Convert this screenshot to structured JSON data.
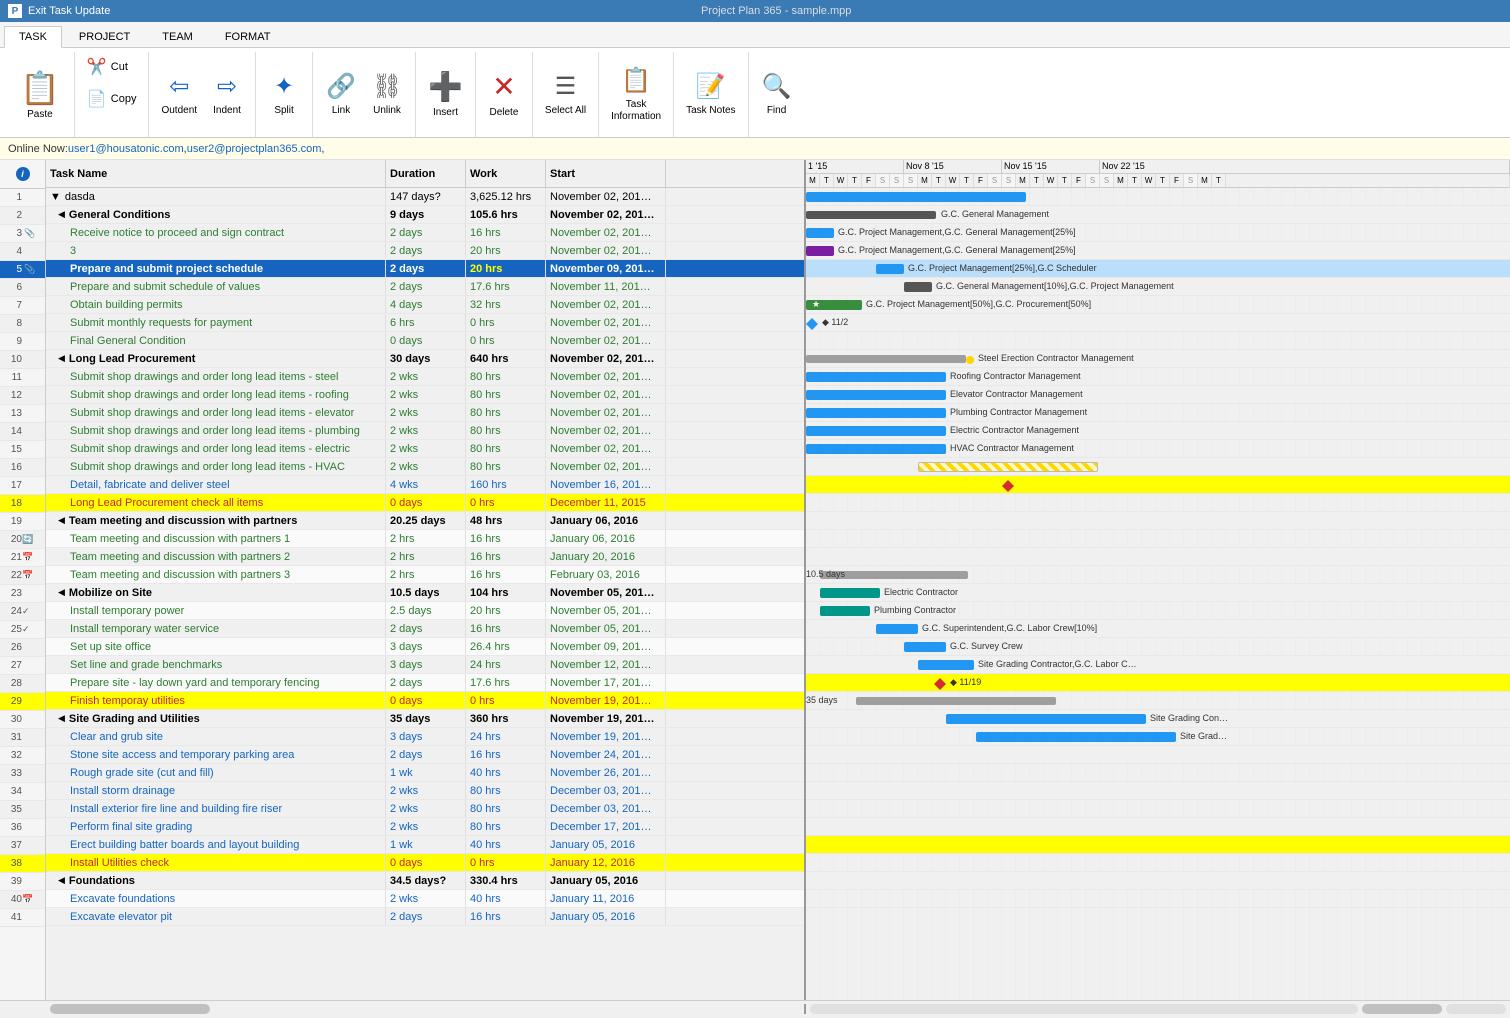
{
  "titlebar": {
    "app_icon": "P",
    "exit_label": "Exit Task Update",
    "window_title": "Project Plan 365 - sample.mpp"
  },
  "ribbon": {
    "tabs": [
      "TASK",
      "PROJECT",
      "TEAM",
      "FORMAT"
    ],
    "active_tab": "TASK",
    "buttons": [
      {
        "id": "paste",
        "label": "Paste",
        "icon": "📋"
      },
      {
        "id": "cut",
        "label": "Cut",
        "icon": "✂️"
      },
      {
        "id": "copy",
        "label": "Copy",
        "icon": "📄"
      },
      {
        "id": "outdent",
        "label": "Outdent",
        "icon": "⇦"
      },
      {
        "id": "indent",
        "label": "Indent",
        "icon": "⇨"
      },
      {
        "id": "split",
        "label": "Split",
        "icon": "✦"
      },
      {
        "id": "link",
        "label": "Link",
        "icon": "🔗"
      },
      {
        "id": "unlink",
        "label": "Unlink",
        "icon": "⛓"
      },
      {
        "id": "insert",
        "label": "Insert",
        "icon": "➕"
      },
      {
        "id": "delete",
        "label": "Delete",
        "icon": "✕"
      },
      {
        "id": "select-all",
        "label": "Select All",
        "icon": "☰"
      },
      {
        "id": "task-information",
        "label": "Task Information",
        "icon": "📋"
      },
      {
        "id": "task-notes",
        "label": "Task Notes",
        "icon": "📝"
      },
      {
        "id": "find",
        "label": "Find",
        "icon": "🔍"
      }
    ]
  },
  "online_bar": {
    "prefix": "Online Now: ",
    "users": [
      "user1@housatonic.com",
      "user2@projectplan365.com"
    ]
  },
  "columns": {
    "headers": [
      "",
      "ℹ",
      "Task Name",
      "Duration",
      "Work",
      "Start"
    ]
  },
  "rows": [
    {
      "id": 1,
      "indent": 0,
      "name": "dasda",
      "duration": "147 days?",
      "work": "3,625.12 hrs",
      "start": "November 02, 201",
      "type": "normal"
    },
    {
      "id": 2,
      "indent": 1,
      "name": "General Conditions",
      "duration": "9 days",
      "work": "105.6 hrs",
      "start": "November 02, 201",
      "type": "summary",
      "collapsed": false
    },
    {
      "id": 3,
      "indent": 2,
      "name": "Receive notice to proceed and sign contract",
      "duration": "2 days",
      "work": "16 hrs",
      "start": "November 02, 201",
      "type": "green"
    },
    {
      "id": 4,
      "indent": 2,
      "name": "3",
      "duration": "2 days",
      "work": "20 hrs",
      "start": "November 02, 201",
      "type": "green"
    },
    {
      "id": 5,
      "indent": 2,
      "name": "Prepare and submit project schedule",
      "duration": "2 days",
      "work": "20 hrs",
      "start": "November 09, 201",
      "type": "selected",
      "icon": "clip"
    },
    {
      "id": 6,
      "indent": 2,
      "name": "Prepare and submit schedule of values",
      "duration": "2 days",
      "work": "17.6 hrs",
      "start": "November 11, 201",
      "type": "green"
    },
    {
      "id": 7,
      "indent": 2,
      "name": "Obtain building permits",
      "duration": "4 days",
      "work": "32 hrs",
      "start": "November 02, 201",
      "type": "green"
    },
    {
      "id": 8,
      "indent": 2,
      "name": "Submit monthly requests for payment",
      "duration": "6 hrs",
      "work": "0 hrs",
      "start": "November 02, 201",
      "type": "green"
    },
    {
      "id": 9,
      "indent": 2,
      "name": "Final General Condition",
      "duration": "0 days",
      "work": "0 hrs",
      "start": "November 02, 201",
      "type": "green"
    },
    {
      "id": 10,
      "indent": 1,
      "name": "Long Lead Procurement",
      "duration": "30 days",
      "work": "640 hrs",
      "start": "November 02, 201",
      "type": "summary"
    },
    {
      "id": 11,
      "indent": 2,
      "name": "Submit shop drawings and order long lead items - steel",
      "duration": "2 wks",
      "work": "80 hrs",
      "start": "November 02, 201",
      "type": "green"
    },
    {
      "id": 12,
      "indent": 2,
      "name": "Submit shop drawings and order long lead items - roofing",
      "duration": "2 wks",
      "work": "80 hrs",
      "start": "November 02, 201",
      "type": "green"
    },
    {
      "id": 13,
      "indent": 2,
      "name": "Submit shop drawings and order long lead items - elevator",
      "duration": "2 wks",
      "work": "80 hrs",
      "start": "November 02, 201",
      "type": "green"
    },
    {
      "id": 14,
      "indent": 2,
      "name": "Submit shop drawings and order long lead items - plumbing",
      "duration": "2 wks",
      "work": "80 hrs",
      "start": "November 02, 201",
      "type": "green"
    },
    {
      "id": 15,
      "indent": 2,
      "name": "Submit shop drawings and order long lead items - electric",
      "duration": "2 wks",
      "work": "80 hrs",
      "start": "November 02, 201",
      "type": "green"
    },
    {
      "id": 16,
      "indent": 2,
      "name": "Submit shop drawings and order long lead items - HVAC",
      "duration": "2 wks",
      "work": "80 hrs",
      "start": "November 02, 201",
      "type": "green"
    },
    {
      "id": 17,
      "indent": 2,
      "name": "Detail, fabricate and deliver steel",
      "duration": "4 wks",
      "work": "160 hrs",
      "start": "November 16, 201",
      "type": "blue"
    },
    {
      "id": 18,
      "indent": 2,
      "name": "Long Lead Procurement check all items",
      "duration": "0 days",
      "work": "0 hrs",
      "start": "December 11, 2015",
      "type": "yellow"
    },
    {
      "id": 19,
      "indent": 1,
      "name": "Team meeting and discussion with partners",
      "duration": "20.25 days",
      "work": "48 hrs",
      "start": "January 06, 2016",
      "type": "summary"
    },
    {
      "id": 20,
      "indent": 2,
      "name": "Team meeting and discussion with partners 1",
      "duration": "2 hrs",
      "work": "16 hrs",
      "start": "January 06, 2016",
      "type": "normal",
      "icon": "refresh"
    },
    {
      "id": 21,
      "indent": 2,
      "name": "Team meeting and discussion with partners 2",
      "duration": "2 hrs",
      "work": "16 hrs",
      "start": "January 20, 2016",
      "type": "normal",
      "icon": "cal"
    },
    {
      "id": 22,
      "indent": 2,
      "name": "Team meeting and discussion with partners 3",
      "duration": "2 hrs",
      "work": "16 hrs",
      "start": "February 03, 2016",
      "type": "normal",
      "icon": "cal"
    },
    {
      "id": 23,
      "indent": 1,
      "name": "Mobilize on Site",
      "duration": "10.5 days",
      "work": "104 hrs",
      "start": "November 05, 201",
      "type": "summary"
    },
    {
      "id": 24,
      "indent": 2,
      "name": "Install temporary power",
      "duration": "2.5 days",
      "work": "20 hrs",
      "start": "November 05, 201",
      "type": "green",
      "icon": "check"
    },
    {
      "id": 25,
      "indent": 2,
      "name": "Install temporary water service",
      "duration": "2 days",
      "work": "16 hrs",
      "start": "November 05, 201",
      "type": "green",
      "icon": "check"
    },
    {
      "id": 26,
      "indent": 2,
      "name": "Set up site office",
      "duration": "3 days",
      "work": "26.4 hrs",
      "start": "November 09, 201",
      "type": "green"
    },
    {
      "id": 27,
      "indent": 2,
      "name": "Set line and grade benchmarks",
      "duration": "3 days",
      "work": "24 hrs",
      "start": "November 12, 201",
      "type": "green"
    },
    {
      "id": 28,
      "indent": 2,
      "name": "Prepare site - lay down yard and temporary fencing",
      "duration": "2 days",
      "work": "17.6 hrs",
      "start": "November 17, 201",
      "type": "green"
    },
    {
      "id": 29,
      "indent": 2,
      "name": "Finish temporay utilities",
      "duration": "0 days",
      "work": "0 hrs",
      "start": "November 19, 201",
      "type": "yellow"
    },
    {
      "id": 30,
      "indent": 1,
      "name": "Site Grading and Utilities",
      "duration": "35 days",
      "work": "360 hrs",
      "start": "November 19, 201",
      "type": "summary"
    },
    {
      "id": 31,
      "indent": 2,
      "name": "Clear and grub site",
      "duration": "3 days",
      "work": "24 hrs",
      "start": "November 19, 201",
      "type": "blue"
    },
    {
      "id": 32,
      "indent": 2,
      "name": "Stone site access and temporary parking area",
      "duration": "2 days",
      "work": "16 hrs",
      "start": "November 24, 201",
      "type": "blue"
    },
    {
      "id": 33,
      "indent": 2,
      "name": "Rough grade site (cut and fill)",
      "duration": "1 wk",
      "work": "40 hrs",
      "start": "November 26, 201",
      "type": "blue"
    },
    {
      "id": 34,
      "indent": 2,
      "name": "Install storm drainage",
      "duration": "2 wks",
      "work": "80 hrs",
      "start": "December 03, 201",
      "type": "blue"
    },
    {
      "id": 35,
      "indent": 2,
      "name": "Install exterior fire line and building fire riser",
      "duration": "2 wks",
      "work": "80 hrs",
      "start": "December 03, 201",
      "type": "blue"
    },
    {
      "id": 36,
      "indent": 2,
      "name": "Perform final site grading",
      "duration": "2 wks",
      "work": "80 hrs",
      "start": "December 17, 201",
      "type": "blue"
    },
    {
      "id": 37,
      "indent": 2,
      "name": "Erect building batter boards and layout building",
      "duration": "1 wk",
      "work": "40 hrs",
      "start": "January 05, 2016",
      "type": "blue"
    },
    {
      "id": 38,
      "indent": 2,
      "name": "Install Utilities check",
      "duration": "0 days",
      "work": "0 hrs",
      "start": "January 12, 2016",
      "type": "yellow"
    },
    {
      "id": 39,
      "indent": 1,
      "name": "Foundations",
      "duration": "34.5 days?",
      "work": "330.4 hrs",
      "start": "January 05, 2016",
      "type": "summary"
    },
    {
      "id": 40,
      "indent": 2,
      "name": "Excavate foundations",
      "duration": "2 wks",
      "work": "40 hrs",
      "start": "January 11, 2016",
      "type": "blue",
      "icon": "cal"
    },
    {
      "id": 41,
      "indent": 2,
      "name": "Excavate elevator pit",
      "duration": "2 days",
      "work": "16 hrs",
      "start": "January 05, 2016",
      "type": "blue"
    }
  ],
  "gantt": {
    "weeks": [
      {
        "label": "1 '15",
        "days": [
          "M",
          "T",
          "W",
          "T",
          "F",
          "S",
          "S"
        ]
      },
      {
        "label": "Nov 8 '15",
        "days": [
          "S",
          "M",
          "T",
          "W",
          "T",
          "F",
          "S"
        ]
      },
      {
        "label": "Nov 15 '15",
        "days": [
          "S",
          "M",
          "T",
          "W",
          "T",
          "F",
          "S"
        ]
      },
      {
        "label": "Nov 22 '15",
        "days": [
          "S",
          "M",
          "T",
          "W",
          "T",
          "F",
          "S",
          "M",
          "T"
        ]
      }
    ]
  },
  "colors": {
    "accent": "#1565c0",
    "summary": "#555",
    "green_text": "#2e7d32",
    "blue_text": "#1565c0",
    "yellow_bg": "#ffff00",
    "online_bg": "#fffde7"
  }
}
